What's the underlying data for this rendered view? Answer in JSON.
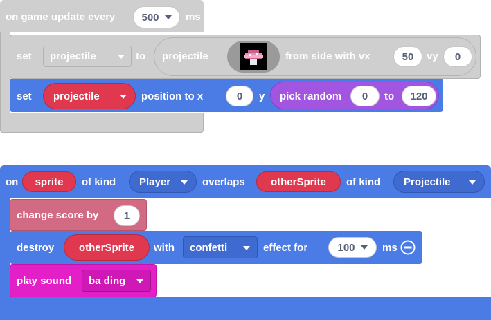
{
  "game_update": {
    "header_prefix": "on game update every",
    "interval_value": "500",
    "interval_unit": "ms",
    "set_label": "set",
    "variable_value": "projectile",
    "to_label": "to",
    "projectile_label": "projectile",
    "from_side_label": "from side with vx",
    "vx_value": "50",
    "vy_label": "vy",
    "vy_value": "0",
    "position_set_label": "set",
    "position_variable": "projectile",
    "position_to_x_label": "position to x",
    "x_value": "0",
    "y_label": "y",
    "pick_random_label": "pick random",
    "random_min": "0",
    "random_to_label": "to",
    "random_max": "120"
  },
  "overlap_event": {
    "on_label": "on",
    "sprite_var": "sprite",
    "of_kind_label_1": "of kind",
    "kind_1": "Player",
    "overlaps_label": "overlaps",
    "other_sprite_var": "otherSprite",
    "of_kind_label_2": "of kind",
    "kind_2": "Projectile",
    "change_score_label": "change score by",
    "score_value": "1",
    "destroy_label": "destroy",
    "destroy_target": "otherSprite",
    "with_label": "with",
    "effect_value": "confetti",
    "effect_for_label": "effect for",
    "duration_value": "100",
    "duration_unit": "ms",
    "play_sound_label": "play sound",
    "sound_value": "ba ding"
  },
  "icons": [
    "chevron-down-icon",
    "minus-circle-icon",
    "mushroom-sprite-icon"
  ],
  "colors": {
    "disabled_block": "#cfcfcf",
    "disabled_border": "#b3b3b3",
    "sprites_blue": "#4b7be5",
    "variable_red": "#e0384f",
    "math_purple": "#a155e0",
    "info_pink": "#d16a82",
    "music_magenta": "#e31fc8"
  }
}
